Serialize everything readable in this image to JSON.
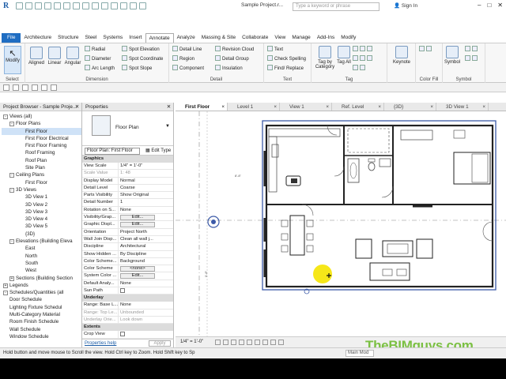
{
  "titlebar": {
    "app_letter": "R",
    "doc_title": "Sample Project.r...",
    "search_placeholder": "Type a keyword or phrase",
    "signin": "Sign In"
  },
  "ribbon_tabs": [
    "File",
    "Architecture",
    "Structure",
    "Steel",
    "Systems",
    "Insert",
    "Annotate",
    "Analyze",
    "Massing & Site",
    "Collaborate",
    "View",
    "Manage",
    "Add-Ins",
    "Modify"
  ],
  "ribbon": {
    "select_label": "Select",
    "modify_label": "Modify",
    "dimension": {
      "label": "Dimension",
      "buttons": [
        "Aligned",
        "Linear",
        "Angular"
      ],
      "small": [
        "Radial",
        "Diameter",
        "Arc Length",
        "Spot Elevation",
        "Spot Coordinate",
        "Spot Slope"
      ]
    },
    "detail": {
      "label": "Detail",
      "small": [
        "Detail Line",
        "Region",
        "Component",
        "Revision Cloud",
        "Detail Group",
        "Insulation"
      ]
    },
    "text": {
      "label": "Text",
      "small": [
        "Text",
        "Check Spelling",
        "Find/ Replace"
      ]
    },
    "tag": {
      "label": "Tag",
      "buttons": [
        "Tag by Category",
        "Tag All"
      ]
    },
    "keynote": "Keynote",
    "color_fill_label": "Color Fill",
    "symbol": {
      "label": "Symbol",
      "button": "Symbol"
    }
  },
  "project_browser": {
    "title": "Project Browser - Sample Proje...",
    "items": [
      {
        "level": 1,
        "text": "Views (all)",
        "tog": "-"
      },
      {
        "level": 2,
        "text": "Floor Plans",
        "tog": "-"
      },
      {
        "level": 3,
        "text": "First Floor",
        "selected": true
      },
      {
        "level": 3,
        "text": "First Floor Electrical"
      },
      {
        "level": 3,
        "text": "First Floor Framing"
      },
      {
        "level": 3,
        "text": "Roof Framing"
      },
      {
        "level": 3,
        "text": "Roof Plan"
      },
      {
        "level": 3,
        "text": "Site Plan"
      },
      {
        "level": 2,
        "text": "Ceiling Plans",
        "tog": "-"
      },
      {
        "level": 3,
        "text": "First Floor"
      },
      {
        "level": 2,
        "text": "3D Views",
        "tog": "-"
      },
      {
        "level": 3,
        "text": "3D View 1"
      },
      {
        "level": 3,
        "text": "3D View 2"
      },
      {
        "level": 3,
        "text": "3D View 3"
      },
      {
        "level": 3,
        "text": "3D View 4"
      },
      {
        "level": 3,
        "text": "3D View 5"
      },
      {
        "level": 3,
        "text": "{3D}"
      },
      {
        "level": 2,
        "text": "Elevations (Building Eleva",
        "tog": "-"
      },
      {
        "level": 3,
        "text": "East"
      },
      {
        "level": 3,
        "text": "North"
      },
      {
        "level": 3,
        "text": "South"
      },
      {
        "level": 3,
        "text": "West"
      },
      {
        "level": 2,
        "text": "Sections (Building Section",
        "tog": "+"
      },
      {
        "level": 1,
        "text": "Legends",
        "tog": "+"
      },
      {
        "level": 1,
        "text": "Schedules/Quantities (all",
        "tog": "-"
      },
      {
        "level": 2,
        "text": "Door Schedule"
      },
      {
        "level": 2,
        "text": "Lighting Fixture Schedul"
      },
      {
        "level": 2,
        "text": "Multi-Category Material"
      },
      {
        "level": 2,
        "text": "Room Finish Schedule"
      },
      {
        "level": 2,
        "text": "Wall Schedule"
      },
      {
        "level": 2,
        "text": "Window Schedule"
      }
    ]
  },
  "properties": {
    "title": "Properties",
    "type_name": "Floor Plan",
    "instance": "Floor Plan: First Floor",
    "edit_type": "Edit Type",
    "sections": [
      {
        "name": "Graphics",
        "rows": [
          {
            "k": "View Scale",
            "v": "1/4\" = 1'-0\""
          },
          {
            "k": "Scale Value",
            "v": "1:  48",
            "grey": true
          },
          {
            "k": "Display Model",
            "v": "Normal"
          },
          {
            "k": "Detail Level",
            "v": "Coarse"
          },
          {
            "k": "Parts Visibility",
            "v": "Show Original"
          },
          {
            "k": "Detail Number",
            "v": "1"
          },
          {
            "k": "Rotation on S...",
            "v": "None"
          },
          {
            "k": "Visibility/Grap...",
            "v": "Edit...",
            "btn": true
          },
          {
            "k": "Graphic Displ...",
            "v": "Edit...",
            "btn": true
          },
          {
            "k": "Orientation",
            "v": "Project North"
          },
          {
            "k": "Wall Join Disp...",
            "v": "Clean all wall j..."
          },
          {
            "k": "Discipline",
            "v": "Architectural"
          },
          {
            "k": "Show Hidden ...",
            "v": "By Discipline"
          },
          {
            "k": "Color Scheme...",
            "v": "Background"
          },
          {
            "k": "Color Scheme",
            "v": "<none>",
            "btn": true
          },
          {
            "k": "System Color ...",
            "v": "Edit...",
            "btn": true
          },
          {
            "k": "Default Analy...",
            "v": "None"
          },
          {
            "k": "Sun Path",
            "v": ""
          }
        ]
      },
      {
        "name": "Underlay",
        "rows": [
          {
            "k": "Range: Base L...",
            "v": "None"
          },
          {
            "k": "Range: Top Le...",
            "v": "Unbounded",
            "grey": true
          },
          {
            "k": "Underlay Orie...",
            "v": "Look down",
            "grey": true
          }
        ]
      },
      {
        "name": "Extents",
        "rows": [
          {
            "k": "Crop View",
            "v": ""
          }
        ]
      }
    ],
    "help_link": "Properties help",
    "apply": "Apply"
  },
  "view_tabs": [
    {
      "label": "First Floor",
      "active": true
    },
    {
      "label": "Level 1"
    },
    {
      "label": "View 1"
    },
    {
      "label": "Ref. Level"
    },
    {
      "label": "{3D}"
    },
    {
      "label": "3D View 1"
    }
  ],
  "view_control": {
    "scale": "1/4\" = 1'-0\""
  },
  "statusbar": {
    "message": "Hold button and move mouse to Scroll the view. Hold Ctrl key to Zoom. Hold Shift key to Sp",
    "model": "Main Mod"
  },
  "watermark": "TheBIMguys.com",
  "colors": {
    "accent": "#1f6dc2",
    "selection": "#cfe2f7",
    "watermark": "#7bc043",
    "cursor_highlight": "#f5e400",
    "crop_region": "#3c5aa8"
  }
}
